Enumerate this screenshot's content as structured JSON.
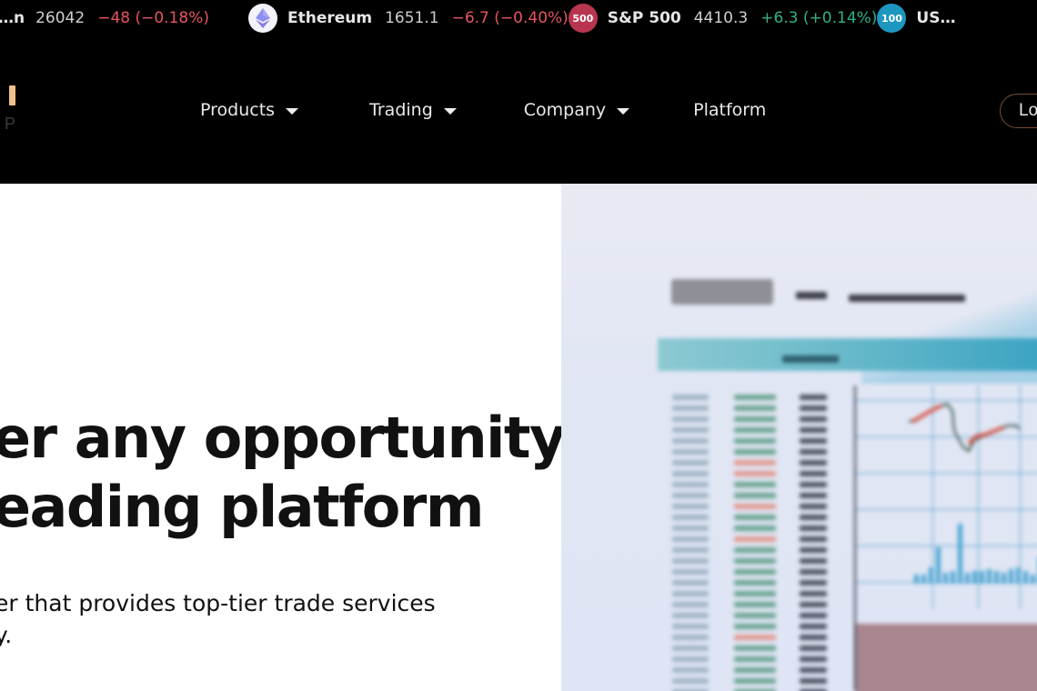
{
  "ticker": {
    "items": [
      {
        "symbol": "…n",
        "price": "26042",
        "change": "−48 (−0.18%)",
        "direction": "neg",
        "icon": "",
        "badge_color": ""
      },
      {
        "symbol": "Ethereum",
        "price": "1651.1",
        "change": "−6.7 (−0.40%)",
        "direction": "neg",
        "icon": "ethereum-icon",
        "badge_color": "#f3f3fb"
      },
      {
        "symbol": "S&P 500",
        "price": "4410.3",
        "change": "+6.3 (+0.14%)",
        "direction": "pos",
        "icon": "500",
        "badge_color": "#b8354f"
      },
      {
        "symbol": "US…",
        "price": "",
        "change": "",
        "direction": "pos",
        "icon": "100",
        "badge_color": "#1d97c0"
      }
    ],
    "colors": {
      "negative": "#e5565f",
      "positive": "#2fb08a"
    }
  },
  "nav": {
    "logo": {
      "mark_color": "#efbf8c",
      "sub_letter": "P"
    },
    "menu": [
      {
        "label": "Products",
        "has_dropdown": true
      },
      {
        "label": "Trading",
        "has_dropdown": true
      },
      {
        "label": "Company",
        "has_dropdown": true
      },
      {
        "label": "Platform",
        "has_dropdown": false
      }
    ],
    "login_label": "Lo"
  },
  "hero": {
    "title_lines": [
      "er any opportunity",
      "eading platform"
    ],
    "subtitle_lines": [
      "er that provides top-tier trade services",
      "y."
    ],
    "image": "blurred-trading-terminal-image"
  }
}
